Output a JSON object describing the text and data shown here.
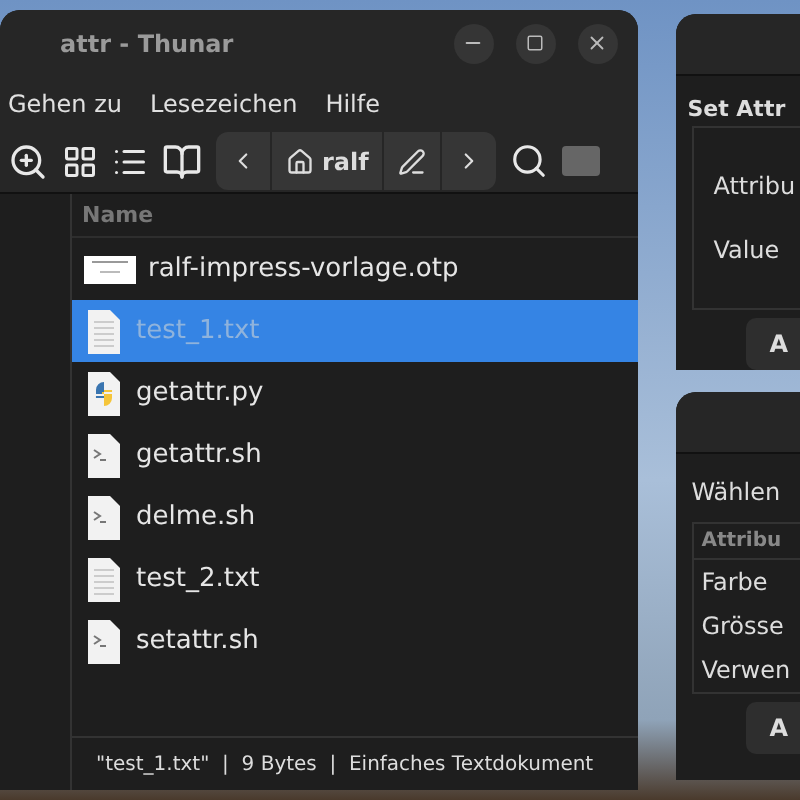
{
  "window": {
    "title": "attr - Thunar"
  },
  "menu": [
    "Gehen zu",
    "Lesezeichen",
    "Hilfe"
  ],
  "path_bar": {
    "location": "ralf"
  },
  "file_list": {
    "column": "Name",
    "files": [
      {
        "name": "ralf-impress-vorlage.otp",
        "kind": "presentation",
        "selected": false
      },
      {
        "name": "test_1.txt",
        "kind": "text",
        "selected": true
      },
      {
        "name": "getattr.py",
        "kind": "python",
        "selected": false
      },
      {
        "name": "getattr.sh",
        "kind": "script",
        "selected": false
      },
      {
        "name": "delme.sh",
        "kind": "script",
        "selected": false
      },
      {
        "name": "test_2.txt",
        "kind": "text",
        "selected": false
      },
      {
        "name": "setattr.sh",
        "kind": "script",
        "selected": false
      }
    ]
  },
  "status_bar": "\"test_1.txt\"  |  9 Bytes  |  Einfaches Textdokument",
  "set_attr_window": {
    "group_title": "Set Attr",
    "labels": [
      "Attribu",
      "Value"
    ],
    "button": "A"
  },
  "select_window": {
    "prompt": "Wählen",
    "column_header": "Attribu",
    "rows": [
      "Farbe",
      "Grösse",
      "Verwen"
    ],
    "button": "A"
  }
}
